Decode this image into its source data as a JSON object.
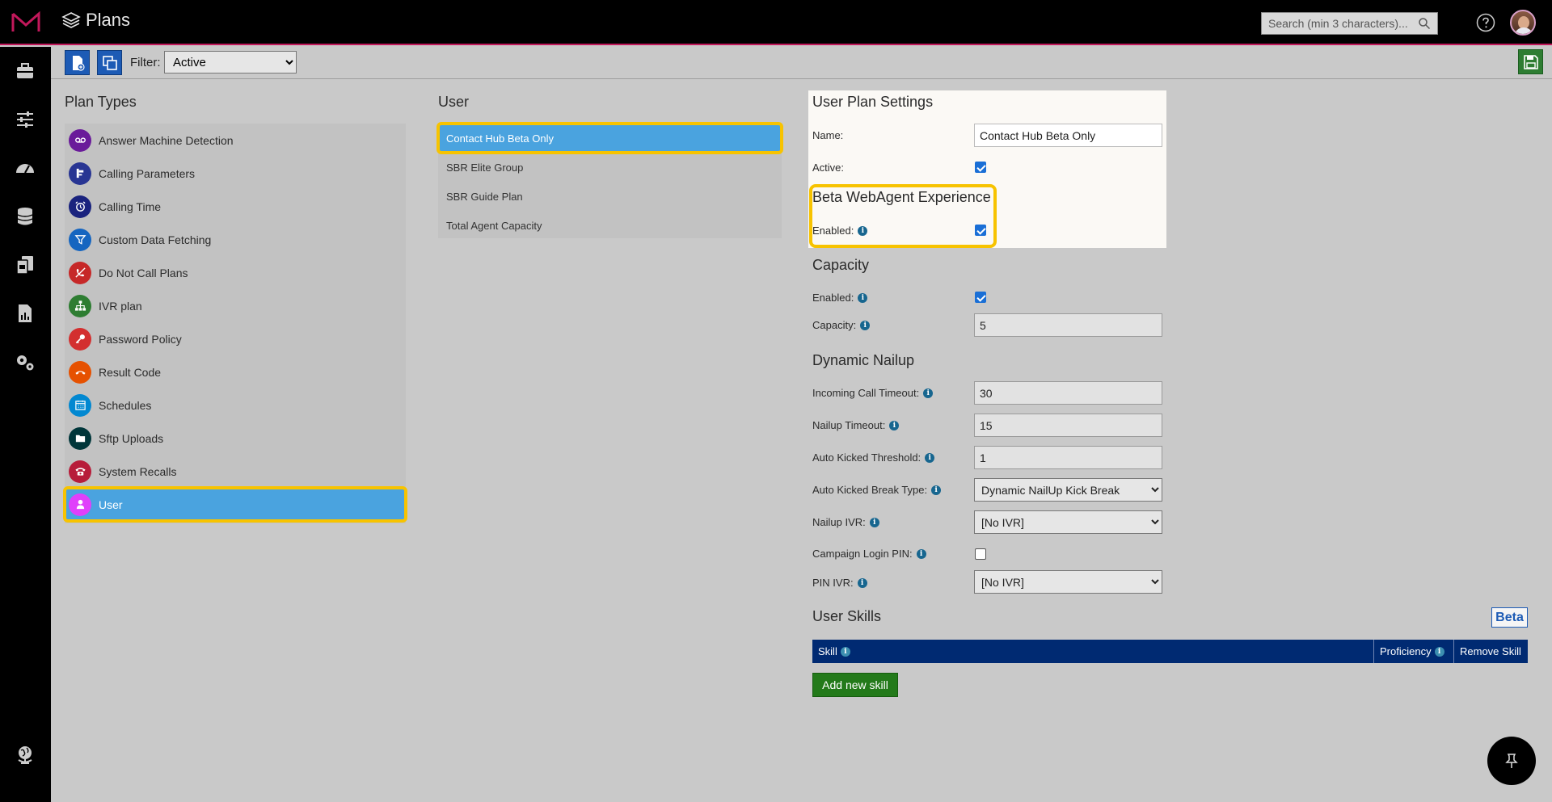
{
  "header": {
    "title": "Plans",
    "search_placeholder": "Search (min 3 characters)..."
  },
  "toolbar": {
    "filter_label": "Filter:",
    "filter_value": "Active"
  },
  "plan_types": {
    "title": "Plan Types",
    "items": [
      {
        "label": "Answer Machine Detection",
        "icon": "voicemail-icon",
        "color": "#6a1b9a"
      },
      {
        "label": "Calling Parameters",
        "icon": "sliders-icon",
        "color": "#283593"
      },
      {
        "label": "Calling Time",
        "icon": "alarm-clock-icon",
        "color": "#1a237e"
      },
      {
        "label": "Custom Data Fetching",
        "icon": "filter-icon",
        "color": "#1565c0"
      },
      {
        "label": "Do Not Call Plans",
        "icon": "phone-slash-icon",
        "color": "#c62828"
      },
      {
        "label": "IVR plan",
        "icon": "sitemap-icon",
        "color": "#2e7d32"
      },
      {
        "label": "Password Policy",
        "icon": "key-icon",
        "color": "#d32f2f"
      },
      {
        "label": "Result Code",
        "icon": "hangup-icon",
        "color": "#e65100"
      },
      {
        "label": "Schedules",
        "icon": "calendar-icon",
        "color": "#0288d1"
      },
      {
        "label": "Sftp Uploads",
        "icon": "folder-icon",
        "color": "#00363a"
      },
      {
        "label": "System Recalls",
        "icon": "phone-icon",
        "color": "#b71c3a"
      },
      {
        "label": "User",
        "icon": "user-icon",
        "color": "#e040fb"
      }
    ]
  },
  "user_list": {
    "title": "User",
    "items": [
      "Contact Hub Beta Only",
      "SBR Elite Group",
      "SBR Guide Plan",
      "Total Agent Capacity"
    ]
  },
  "settings": {
    "title": "User Plan Settings",
    "name_label": "Name:",
    "name_value": "Contact Hub Beta Only",
    "active_label": "Active:",
    "beta_title": "Beta WebAgent Experience",
    "beta_enabled_label": "Enabled:",
    "capacity_title": "Capacity",
    "capacity_enabled_label": "Enabled:",
    "capacity_label": "Capacity:",
    "capacity_value": "5",
    "nailup_title": "Dynamic Nailup",
    "incoming_timeout_label": "Incoming Call Timeout:",
    "incoming_timeout_value": "30",
    "nailup_timeout_label": "Nailup Timeout:",
    "nailup_timeout_value": "15",
    "auto_kicked_threshold_label": "Auto Kicked Threshold:",
    "auto_kicked_threshold_value": "1",
    "auto_kicked_break_label": "Auto Kicked Break Type:",
    "auto_kicked_break_value": "Dynamic NailUp Kick Break",
    "nailup_ivr_label": "Nailup IVR:",
    "nailup_ivr_value": "[No IVR]",
    "campaign_pin_label": "Campaign Login PIN:",
    "pin_ivr_label": "PIN IVR:",
    "pin_ivr_value": "[No IVR]"
  },
  "skills": {
    "title": "User Skills",
    "beta_badge": "Beta",
    "col_skill": "Skill",
    "col_proficiency": "Proficiency",
    "col_remove": "Remove Skill",
    "add_button": "Add new skill"
  },
  "colors": {
    "selected": "#4aa3df",
    "highlight": "#f7c300",
    "brand": "#c2185b",
    "table_header": "#002a72"
  }
}
